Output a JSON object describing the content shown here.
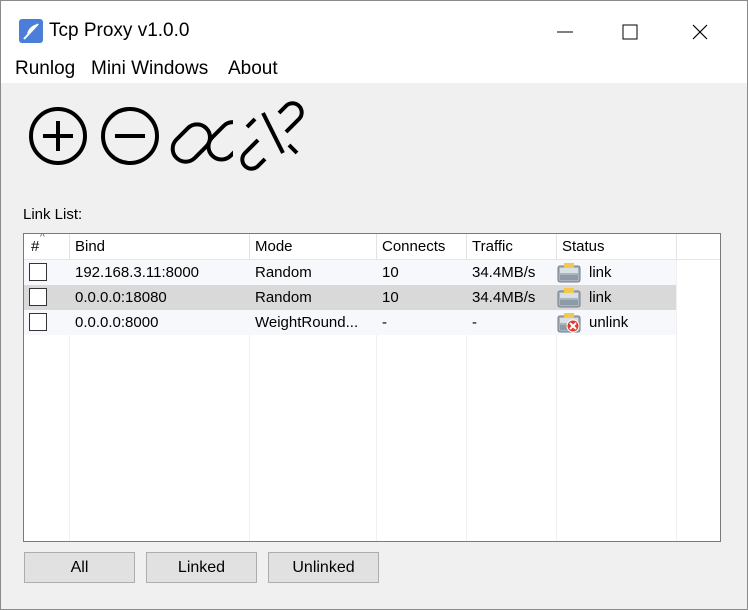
{
  "window": {
    "title": "Tcp Proxy v1.0.0",
    "icon": "feather-pen-icon",
    "controls": [
      "minimize-icon",
      "maximize-icon",
      "close-icon"
    ]
  },
  "menu": {
    "items": [
      "Runlog",
      "Mini Windows",
      "About"
    ]
  },
  "toolbar": {
    "buttons": [
      "plus-circle-icon",
      "minus-circle-icon",
      "link-icon",
      "unlink-icon"
    ]
  },
  "link_list": {
    "label": "Link List:",
    "columns": [
      "#",
      "Bind",
      "Mode",
      "Connects",
      "Traffic",
      "Status"
    ],
    "rows": [
      {
        "checked": false,
        "bind": "192.168.3.11:8000",
        "mode": "Random",
        "connects": "10",
        "traffic": "34.4MB/s",
        "status": "link",
        "status_icon": "drive-ok-icon"
      },
      {
        "checked": false,
        "bind": "0.0.0.0:18080",
        "mode": "Random",
        "connects": "10",
        "traffic": "34.4MB/s",
        "status": "link",
        "status_icon": "drive-ok-icon"
      },
      {
        "checked": false,
        "bind": "0.0.0.0:8000",
        "mode": "WeightRound...",
        "connects": "-",
        "traffic": "-",
        "status": "unlink",
        "status_icon": "drive-error-icon"
      }
    ]
  },
  "filters": {
    "all": "All",
    "linked": "Linked",
    "unlinked": "Unlinked"
  },
  "colors": {
    "selected_row": "#d9d9d9",
    "row_background": "#f7f8fc",
    "error_red": "#e03a2e"
  }
}
